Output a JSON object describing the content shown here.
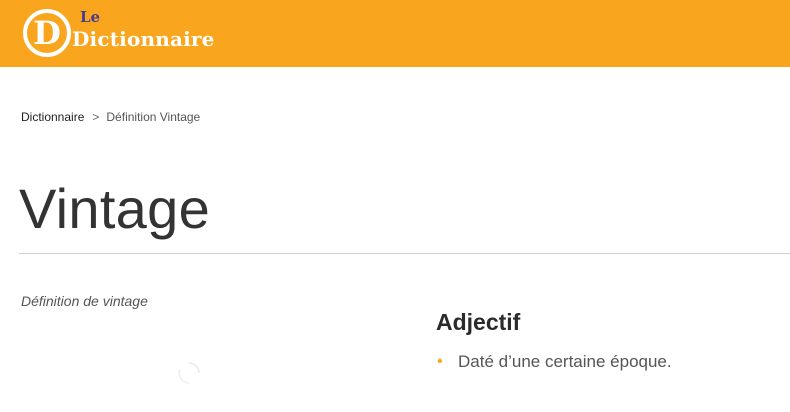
{
  "header": {
    "logo": {
      "prefix": "Le",
      "word": "Dictionnaire",
      "mark_letter": "D"
    },
    "background_color": "#f9a61e"
  },
  "breadcrumb": {
    "home": "Dictionnaire",
    "separator": ">",
    "current": "Définition Vintage"
  },
  "page": {
    "title": "Vintage",
    "definition_label": "Définition de vintage"
  },
  "entry": {
    "part_of_speech": "Adjectif",
    "definitions": [
      "Daté d’une certaine époque."
    ],
    "bullet": "•"
  },
  "colors": {
    "accent": "#f9a61e",
    "text_dark": "#333333",
    "text_muted": "#555555",
    "logo_le": "#4a3b8c"
  }
}
